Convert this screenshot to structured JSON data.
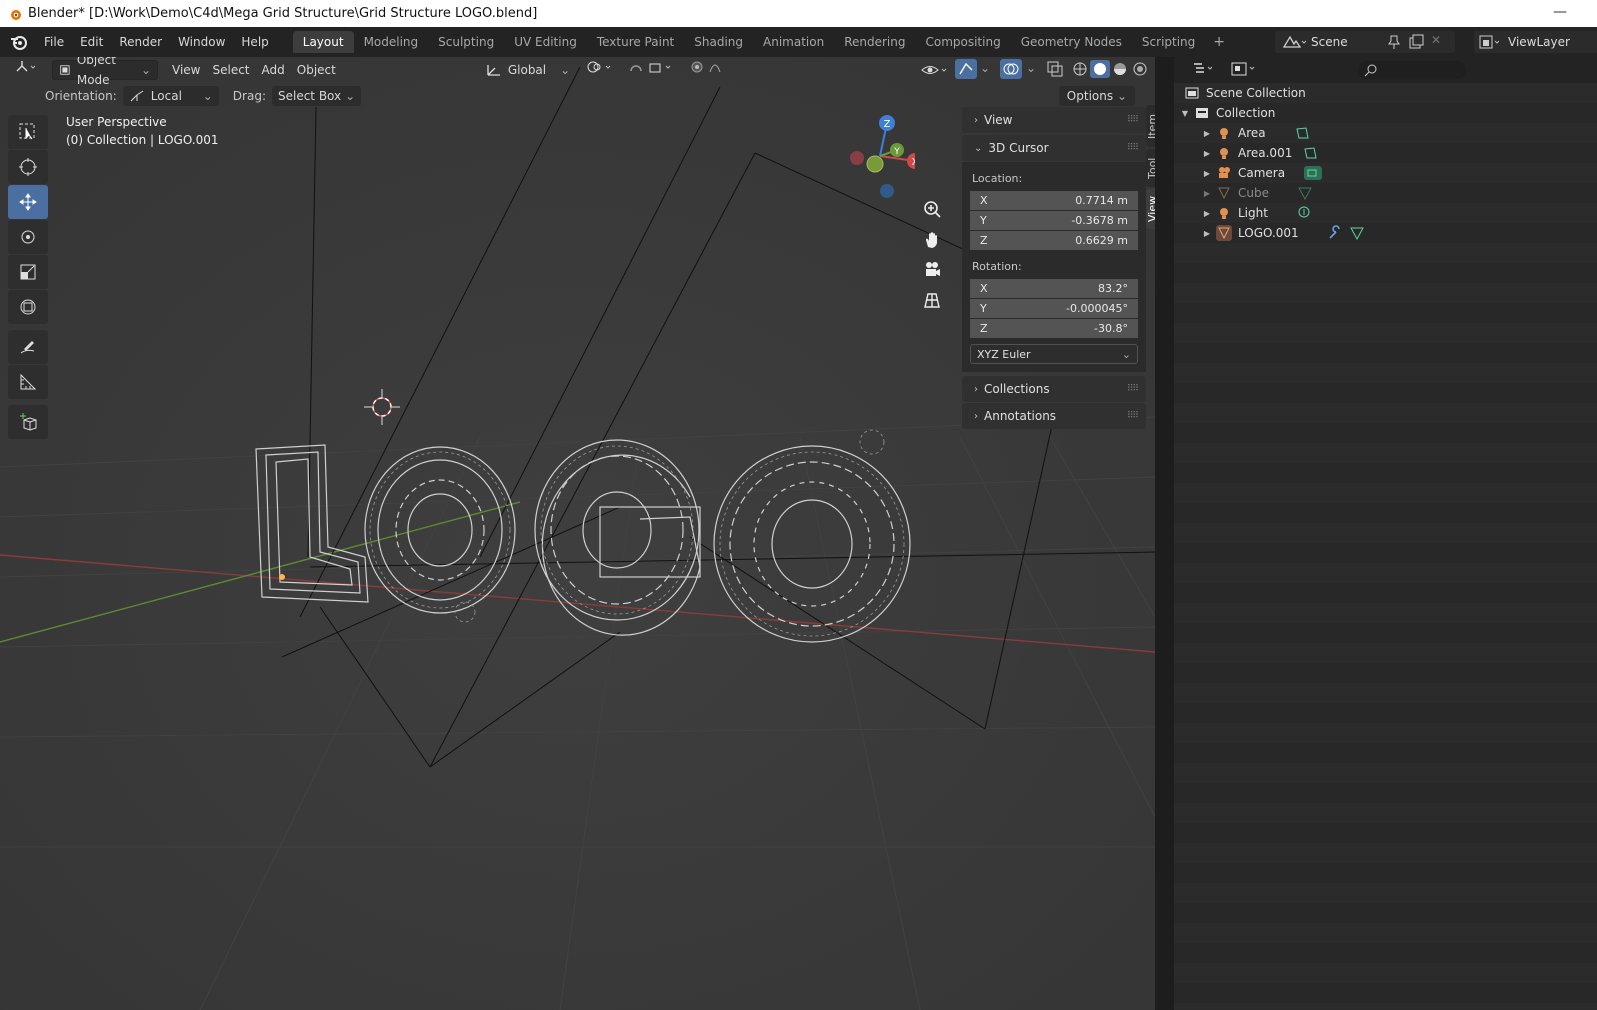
{
  "window": {
    "title": "Blender* [D:\\Work\\Demo\\C4d\\Mega Grid Structure\\Grid Structure LOGO.blend]",
    "minimize": "—"
  },
  "menu": [
    "File",
    "Edit",
    "Render",
    "Window",
    "Help"
  ],
  "workspaces": [
    {
      "label": "Layout",
      "active": true
    },
    {
      "label": "Modeling"
    },
    {
      "label": "Sculpting"
    },
    {
      "label": "UV Editing"
    },
    {
      "label": "Texture Paint"
    },
    {
      "label": "Shading"
    },
    {
      "label": "Animation"
    },
    {
      "label": "Rendering"
    },
    {
      "label": "Compositing"
    },
    {
      "label": "Geometry Nodes"
    },
    {
      "label": "Scripting"
    }
  ],
  "workspace_add": "+",
  "scene": {
    "label": "Scene"
  },
  "view_layer": {
    "label": "ViewLayer"
  },
  "viewport": {
    "mode": "Object Mode",
    "header_menus": [
      "View",
      "Select",
      "Add",
      "Object"
    ],
    "transform_orientation": "Global",
    "tool_settings": {
      "orientation_label": "Orientation:",
      "orientation_value": "Local",
      "drag_label": "Drag:",
      "drag_value": "Select Box",
      "options": "Options"
    },
    "info_line1": "User Perspective",
    "info_line2": "(0) Collection | LOGO.001",
    "gizmo": {
      "z": "Z",
      "y": "Y",
      "x": "X"
    },
    "colors": {
      "x_axis": "#a83b3b",
      "y_axis": "#6a9a3a",
      "z_axis": "#3f7fd6",
      "active_tool": "#4a6fa0"
    }
  },
  "npanel": {
    "view_section": "View",
    "cursor_section": "3D Cursor",
    "location_label": "Location:",
    "location": [
      {
        "axis": "X",
        "value": "0.7714 m"
      },
      {
        "axis": "Y",
        "value": "-0.3678 m"
      },
      {
        "axis": "Z",
        "value": "0.6629 m"
      }
    ],
    "rotation_label": "Rotation:",
    "rotation": [
      {
        "axis": "X",
        "value": "83.2°"
      },
      {
        "axis": "Y",
        "value": "-0.000045°"
      },
      {
        "axis": "Z",
        "value": "-30.8°"
      }
    ],
    "rotation_mode": "XYZ Euler",
    "collections_section": "Collections",
    "annotations_section": "Annotations",
    "tabs": [
      "Item",
      "Tool",
      "View"
    ]
  },
  "outliner": {
    "scene_collection": "Scene Collection",
    "collection": "Collection",
    "items": [
      {
        "label": "Area",
        "icon": "light-icon",
        "dim": false
      },
      {
        "label": "Area.001",
        "icon": "light-icon",
        "dim": false
      },
      {
        "label": "Camera",
        "icon": "camera-icon",
        "dim": false
      },
      {
        "label": "Cube",
        "icon": "mesh-icon",
        "dim": true
      },
      {
        "label": "Light",
        "icon": "light-icon",
        "dim": false
      },
      {
        "label": "LOGO.001",
        "icon": "mesh-icon",
        "dim": false
      }
    ]
  }
}
